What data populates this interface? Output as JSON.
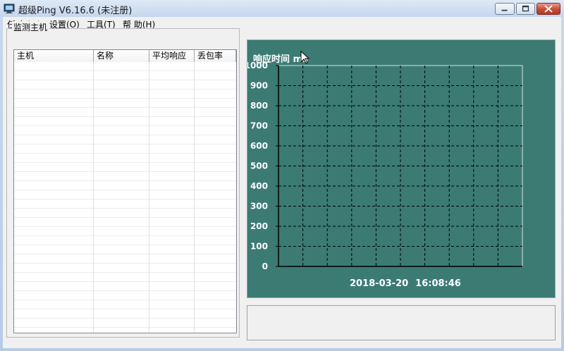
{
  "window": {
    "title": "超级Ping V6.16.6  (未注册)",
    "icon": "app-monitor-icon",
    "buttons": [
      "minimize-icon",
      "maximize-icon",
      "close-icon"
    ]
  },
  "menu": {
    "items": [
      "任 务(M)",
      "设置(O)",
      "工具(T)",
      "帮 助(H)"
    ]
  },
  "hosts_panel": {
    "group_title": "监测主机",
    "columns": [
      "主机",
      "名称",
      "平均响应",
      "丢包率"
    ],
    "rows": []
  },
  "chart_panel": {
    "title": "响应时间 ms",
    "timestamp_date": "2018-03-20",
    "timestamp_time": "16:08:46",
    "background_color": "#3b7b73",
    "grid_color": "#000000"
  },
  "chart_data": {
    "type": "line",
    "title": "响应时间 ms",
    "ylabel": "",
    "xlabel": "",
    "ylim": [
      0,
      1000
    ],
    "yticks": [
      "0",
      "100",
      "200",
      "300",
      "400",
      "500",
      "600",
      "700",
      "800",
      "900",
      "1000"
    ],
    "grid": true,
    "series": []
  },
  "status": {
    "text": ""
  }
}
